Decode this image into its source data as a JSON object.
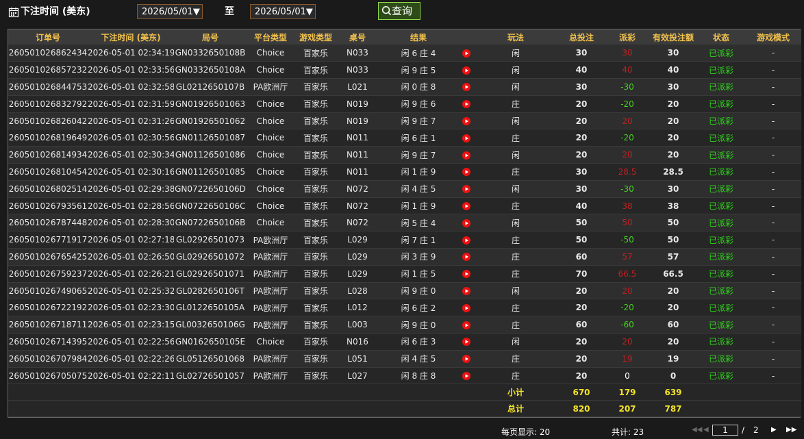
{
  "filter": {
    "label": "下注时间 (美东)",
    "from": "2026/05/01▼",
    "to_label": "至",
    "to": "2026/05/01▼",
    "query_label": "查询"
  },
  "table": {
    "headers": [
      "订单号",
      "下注时间 (美东)",
      "局号",
      "平台类型",
      "游戏类型",
      "桌号",
      "结果",
      "",
      "玩法",
      "总投注",
      "派彩",
      "有效投注额",
      "状态",
      "游戏模式"
    ],
    "rows": [
      {
        "order": "260501026862434",
        "time": "2026-05-01 02:34:19",
        "round": "GN0332650108B",
        "platform": "Choice",
        "game": "百家乐",
        "table": "N033",
        "result": "闲 6 庄 4",
        "bet": "闲",
        "total": "30",
        "payout": "30",
        "valid": "30",
        "status": "已派彩",
        "mode": "-"
      },
      {
        "order": "260501026857232",
        "time": "2026-05-01 02:33:56",
        "round": "GN0332650108A",
        "platform": "Choice",
        "game": "百家乐",
        "table": "N033",
        "result": "闲 9 庄 5",
        "bet": "闲",
        "total": "40",
        "payout": "40",
        "valid": "40",
        "status": "已派彩",
        "mode": "-"
      },
      {
        "order": "260501026844753",
        "time": "2026-05-01 02:32:58",
        "round": "GL0212650107B",
        "platform": "PA欧洲厅",
        "game": "百家乐",
        "table": "L021",
        "result": "闲 0 庄 8",
        "bet": "闲",
        "total": "30",
        "payout": "-30",
        "valid": "30",
        "status": "已派彩",
        "mode": "-"
      },
      {
        "order": "260501026832792",
        "time": "2026-05-01 02:31:59",
        "round": "GN01926501063",
        "platform": "Choice",
        "game": "百家乐",
        "table": "N019",
        "result": "闲 9 庄 6",
        "bet": "庄",
        "total": "20",
        "payout": "-20",
        "valid": "20",
        "status": "已派彩",
        "mode": "-"
      },
      {
        "order": "260501026826042",
        "time": "2026-05-01 02:31:26",
        "round": "GN01926501062",
        "platform": "Choice",
        "game": "百家乐",
        "table": "N019",
        "result": "闲 9 庄 7",
        "bet": "闲",
        "total": "20",
        "payout": "20",
        "valid": "20",
        "status": "已派彩",
        "mode": "-"
      },
      {
        "order": "260501026819649",
        "time": "2026-05-01 02:30:56",
        "round": "GN01126501087",
        "platform": "Choice",
        "game": "百家乐",
        "table": "N011",
        "result": "闲 6 庄 1",
        "bet": "庄",
        "total": "20",
        "payout": "-20",
        "valid": "20",
        "status": "已派彩",
        "mode": "-"
      },
      {
        "order": "260501026814934",
        "time": "2026-05-01 02:30:34",
        "round": "GN01126501086",
        "platform": "Choice",
        "game": "百家乐",
        "table": "N011",
        "result": "闲 9 庄 7",
        "bet": "闲",
        "total": "20",
        "payout": "20",
        "valid": "20",
        "status": "已派彩",
        "mode": "-"
      },
      {
        "order": "260501026810454",
        "time": "2026-05-01 02:30:16",
        "round": "GN01126501085",
        "platform": "Choice",
        "game": "百家乐",
        "table": "N011",
        "result": "闲 1 庄 9",
        "bet": "庄",
        "total": "30",
        "payout": "28.5",
        "valid": "28.5",
        "status": "已派彩",
        "mode": "-"
      },
      {
        "order": "260501026802514",
        "time": "2026-05-01 02:29:38",
        "round": "GN0722650106D",
        "platform": "Choice",
        "game": "百家乐",
        "table": "N072",
        "result": "闲 4 庄 5",
        "bet": "闲",
        "total": "30",
        "payout": "-30",
        "valid": "30",
        "status": "已派彩",
        "mode": "-"
      },
      {
        "order": "260501026793561",
        "time": "2026-05-01 02:28:56",
        "round": "GN0722650106C",
        "platform": "Choice",
        "game": "百家乐",
        "table": "N072",
        "result": "闲 1 庄 9",
        "bet": "庄",
        "total": "40",
        "payout": "38",
        "valid": "38",
        "status": "已派彩",
        "mode": "-"
      },
      {
        "order": "260501026787448",
        "time": "2026-05-01 02:28:30",
        "round": "GN0722650106B",
        "platform": "Choice",
        "game": "百家乐",
        "table": "N072",
        "result": "闲 5 庄 4",
        "bet": "闲",
        "total": "50",
        "payout": "50",
        "valid": "50",
        "status": "已派彩",
        "mode": "-"
      },
      {
        "order": "260501026771917",
        "time": "2026-05-01 02:27:18",
        "round": "GL02926501073",
        "platform": "PA欧洲厅",
        "game": "百家乐",
        "table": "L029",
        "result": "闲 7 庄 1",
        "bet": "庄",
        "total": "50",
        "payout": "-50",
        "valid": "50",
        "status": "已派彩",
        "mode": "-"
      },
      {
        "order": "260501026765425",
        "time": "2026-05-01 02:26:50",
        "round": "GL02926501072",
        "platform": "PA欧洲厅",
        "game": "百家乐",
        "table": "L029",
        "result": "闲 3 庄 9",
        "bet": "庄",
        "total": "60",
        "payout": "57",
        "valid": "57",
        "status": "已派彩",
        "mode": "-"
      },
      {
        "order": "260501026759237",
        "time": "2026-05-01 02:26:21",
        "round": "GL02926501071",
        "platform": "PA欧洲厅",
        "game": "百家乐",
        "table": "L029",
        "result": "闲 1 庄 5",
        "bet": "庄",
        "total": "70",
        "payout": "66.5",
        "valid": "66.5",
        "status": "已派彩",
        "mode": "-"
      },
      {
        "order": "260501026749065",
        "time": "2026-05-01 02:25:32",
        "round": "GL0282650106T",
        "platform": "PA欧洲厅",
        "game": "百家乐",
        "table": "L028",
        "result": "闲 9 庄 0",
        "bet": "闲",
        "total": "20",
        "payout": "20",
        "valid": "20",
        "status": "已派彩",
        "mode": "-"
      },
      {
        "order": "260501026722192",
        "time": "2026-05-01 02:23:30",
        "round": "GL0122650105A",
        "platform": "PA欧洲厅",
        "game": "百家乐",
        "table": "L012",
        "result": "闲 6 庄 2",
        "bet": "庄",
        "total": "20",
        "payout": "-20",
        "valid": "20",
        "status": "已派彩",
        "mode": "-"
      },
      {
        "order": "260501026718711",
        "time": "2026-05-01 02:23:15",
        "round": "GL0032650106G",
        "platform": "PA欧洲厅",
        "game": "百家乐",
        "table": "L003",
        "result": "闲 9 庄 0",
        "bet": "庄",
        "total": "60",
        "payout": "-60",
        "valid": "60",
        "status": "已派彩",
        "mode": "-"
      },
      {
        "order": "260501026714395",
        "time": "2026-05-01 02:22:56",
        "round": "GN0162650105E",
        "platform": "Choice",
        "game": "百家乐",
        "table": "N016",
        "result": "闲 6 庄 3",
        "bet": "闲",
        "total": "20",
        "payout": "20",
        "valid": "20",
        "status": "已派彩",
        "mode": "-"
      },
      {
        "order": "260501026707984",
        "time": "2026-05-01 02:22:26",
        "round": "GL05126501068",
        "platform": "PA欧洲厅",
        "game": "百家乐",
        "table": "L051",
        "result": "闲 4 庄 5",
        "bet": "庄",
        "total": "20",
        "payout": "19",
        "valid": "19",
        "status": "已派彩",
        "mode": "-"
      },
      {
        "order": "260501026705075",
        "time": "2026-05-01 02:22:11",
        "round": "GL02726501057",
        "platform": "PA欧洲厅",
        "game": "百家乐",
        "table": "L027",
        "result": "闲 8 庄 8",
        "bet": "庄",
        "total": "20",
        "payout": "0",
        "valid": "0",
        "status": "已派彩",
        "mode": "-"
      }
    ],
    "subtotal": {
      "label": "小计",
      "total": "670",
      "payout": "179",
      "valid": "639"
    },
    "grandtotal": {
      "label": "总计",
      "total": "820",
      "payout": "207",
      "valid": "787"
    }
  },
  "pager": {
    "per_page": "每页显示: 20",
    "total": "共计: 23",
    "current": "1",
    "slash": "/",
    "pages": "2"
  },
  "colors": {
    "header_text": "#f3c24c",
    "payout_win": "#44d11f",
    "payout_loss": "#c02020",
    "status": "#2fd41b",
    "footer_text": "#f5e42a",
    "query_border": "#8fd94d",
    "date_border": "#8a5a2b"
  }
}
